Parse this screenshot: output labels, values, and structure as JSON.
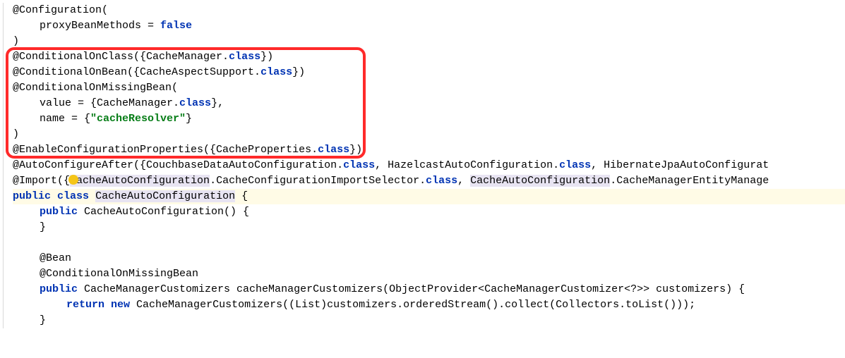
{
  "code": {
    "l1_a": "@Configuration(",
    "l2_a": "proxyBeanMethods = ",
    "l2_b": "false",
    "l3_a": ")",
    "l4_a": "@ConditionalOnClass({CacheManager.",
    "l4_b": "class",
    "l4_c": "})",
    "l5_a": "@ConditionalOnBean({CacheAspectSupport.",
    "l5_b": "class",
    "l5_c": "})",
    "l6_a": "@ConditionalOnMissingBean(",
    "l7_a": "value = {CacheManager.",
    "l7_b": "class",
    "l7_c": "},",
    "l8_a": "name = {",
    "l8_b": "\"cacheResolver\"",
    "l8_c": "}",
    "l9_a": ")",
    "l10_a": "@EnableConfigurationProperties({CacheProperties.",
    "l10_b": "class",
    "l10_c": "})",
    "l11_a": "@AutoConfigureAfter({CouchbaseDataAutoConfiguration.",
    "l11_b": "class",
    "l11_c": ", HazelcastAutoConfiguration.",
    "l11_d": "class",
    "l11_e": ", HibernateJpaAutoConfigurat",
    "l12_a": "@Import({",
    "l12_b": "CacheAutoConfiguration",
    "l12_c": ".CacheConfigurationImportSelector.",
    "l12_d": "class",
    "l12_e": ", ",
    "l12_f": "CacheAutoConfiguration",
    "l12_g": ".CacheManagerEntityManage",
    "l13_a": "public",
    "l13_b": " ",
    "l13_c": "class",
    "l13_d": " ",
    "l13_e": "CacheAutoConfiguration",
    "l13_f": " {",
    "l14_a": "public",
    "l14_b": " CacheAutoConfiguration() {",
    "l15_a": "}",
    "l16_blank": " ",
    "l17_a": "@Bean",
    "l18_a": "@ConditionalOnMissingBean",
    "l19_a": "public",
    "l19_b": " CacheManagerCustomizers cacheManagerCustomizers(ObjectProvider<CacheManagerCustomizer<?>> customizers) {",
    "l20_a": "return",
    "l20_b": " ",
    "l20_c": "new",
    "l20_d": " CacheManagerCustomizers((List)customizers.orderedStream().collect(Collectors.toList()));",
    "l21_a": "}"
  }
}
